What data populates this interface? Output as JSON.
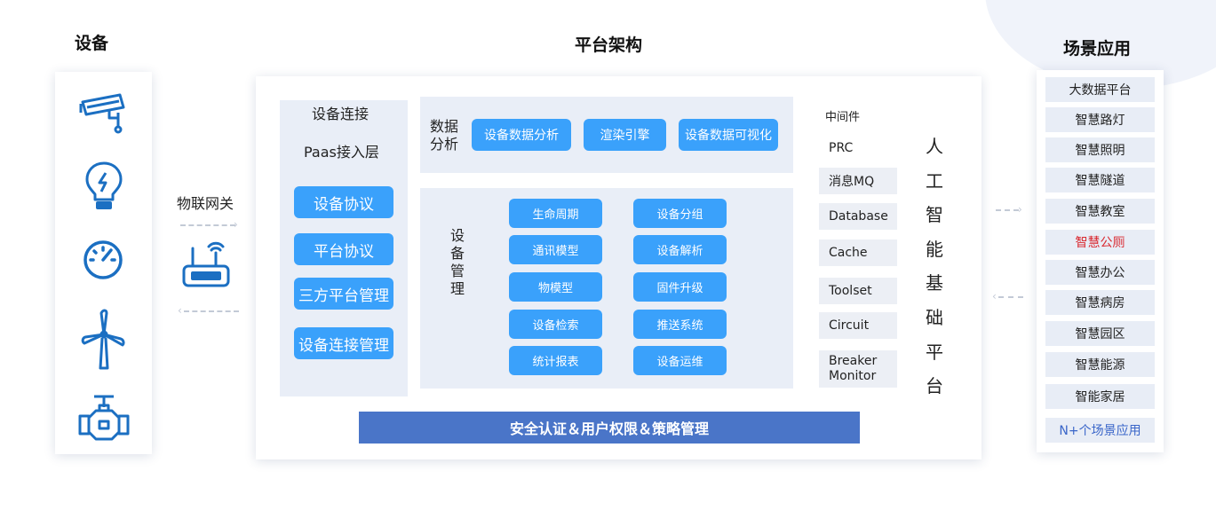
{
  "colors": {
    "accent_blue": "#3aa1fb",
    "security_bar": "#4a75c8",
    "panel_bg": "#e9eef7",
    "icon_blue": "#1b6fc2",
    "highlight_red": "#d9282f",
    "last_scene_text": "#3a66c9"
  },
  "devices": {
    "title": "设备",
    "icons": [
      "cctv-camera-icon",
      "smart-bulb-icon",
      "gauge-meter-icon",
      "wind-turbine-icon",
      "pipe-valve-icon"
    ]
  },
  "gateway": {
    "label": "物联网关",
    "icon": "router-icon"
  },
  "platform": {
    "title": "平台架构",
    "connection": {
      "title": "设备连接",
      "subtitle": "Paas接入层",
      "buttons": [
        "设备协议",
        "平台协议",
        "三方平台管理",
        "设备连接管理"
      ]
    },
    "data_analysis": {
      "label_line1": "数据",
      "label_line2": "分析",
      "buttons": [
        "设备数据分析",
        "渲染引擎",
        "设备数据可视化"
      ]
    },
    "device_management": {
      "label": [
        "设",
        "备",
        "管",
        "理"
      ],
      "left_buttons": [
        "生命周期",
        "通讯模型",
        "物模型",
        "设备检索",
        "统计报表"
      ],
      "right_buttons": [
        "设备分组",
        "设备解析",
        "固件升级",
        "推送系统",
        "设备运维"
      ]
    },
    "middleware": {
      "title": "中间件",
      "prc": "PRC",
      "items": [
        "消息MQ",
        "Database",
        "Cache",
        "Toolset",
        "Circuit"
      ],
      "breaker_line1": "Breaker",
      "breaker_line2": "Monitor"
    },
    "ai_platform": {
      "chars": [
        "人",
        "工",
        "智",
        "能",
        "基",
        "础",
        "平",
        "台"
      ]
    },
    "security_bar": "安全认证＆用户权限＆策略管理"
  },
  "scenes": {
    "title": "场景应用",
    "items": [
      "大数据平台",
      "智慧路灯",
      "智慧照明",
      "智慧隧道",
      "智慧教室",
      "智慧公厕",
      "智慧办公",
      "智慧病房",
      "智慧园区",
      "智慧能源",
      "智能家居"
    ],
    "highlighted": "智慧公厕",
    "last": "N+个场景应用"
  }
}
